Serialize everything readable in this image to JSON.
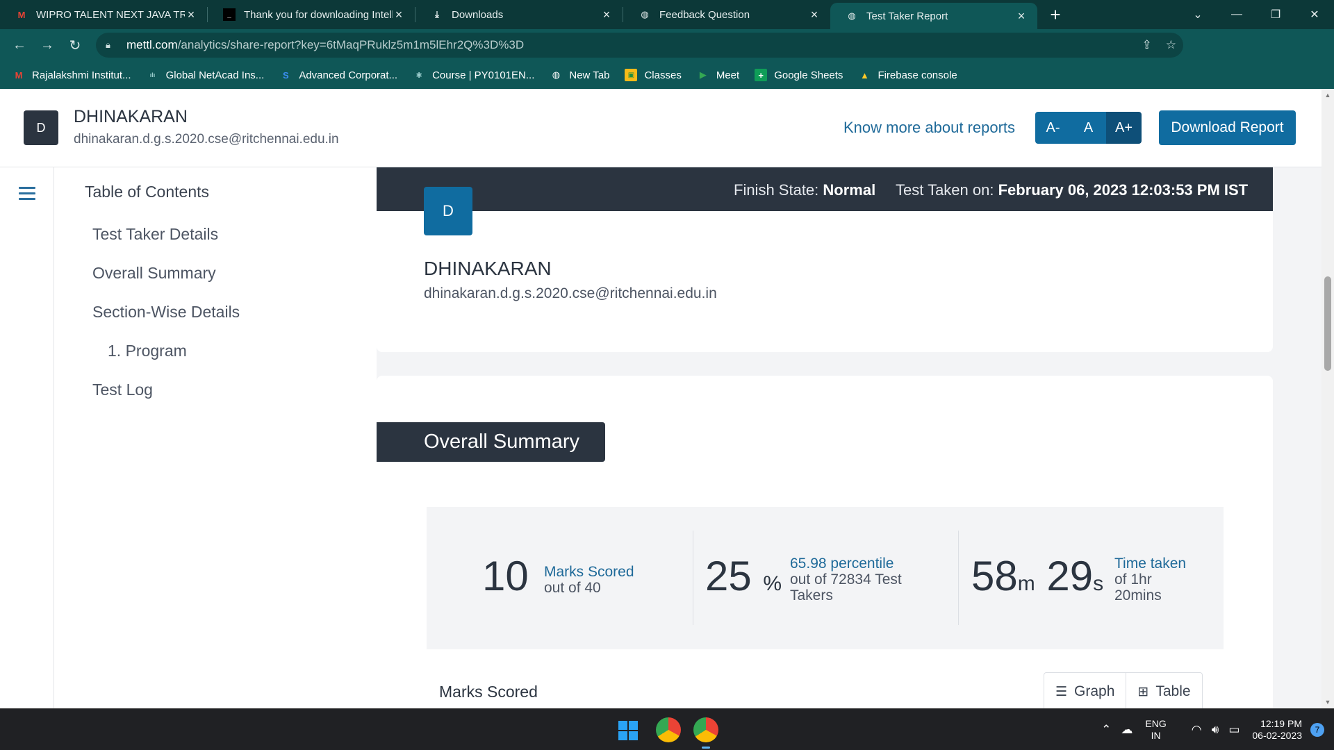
{
  "browser": {
    "tabs": [
      {
        "title": "WIPRO TALENT NEXT JAVA TRAIN",
        "icon": "gmail-icon"
      },
      {
        "title": "Thank you for downloading IntelliJ",
        "icon": "intellij-icon"
      },
      {
        "title": "Downloads",
        "icon": "download-icon"
      },
      {
        "title": "Feedback Question",
        "icon": "globe-icon"
      },
      {
        "title": "Test Taker Report",
        "icon": "globe-icon"
      }
    ],
    "url_host": "mettl.com",
    "url_path": "/analytics/share-report?key=6tMaqPRuklz5m1m5lEhr2Q%3D%3D",
    "bookmarks": [
      {
        "label": "Rajalakshmi Institut...",
        "icon": "gmail-icon"
      },
      {
        "label": "Global NetAcad Ins...",
        "icon": "cisco-icon"
      },
      {
        "label": "Advanced Corporat...",
        "icon": "s-logo-icon"
      },
      {
        "label": "Course | PY0101EN...",
        "icon": "cognitive-icon"
      },
      {
        "label": "New Tab",
        "icon": "globe-icon"
      },
      {
        "label": "Classes",
        "icon": "classroom-icon"
      },
      {
        "label": "Meet",
        "icon": "meet-icon"
      },
      {
        "label": "Google Sheets",
        "icon": "sheets-icon"
      },
      {
        "label": "Firebase console",
        "icon": "firebase-icon"
      }
    ]
  },
  "header": {
    "initial": "D",
    "name": "DHINAKARAN",
    "email": "dhinakaran.d.g.s.2020.cse@ritchennai.edu.in",
    "know_more": "Know more about reports",
    "font_small": "A-",
    "font_normal": "A",
    "font_large": "A+",
    "download": "Download Report"
  },
  "toc": {
    "title": "Table of Contents",
    "items": [
      "Test Taker Details",
      "Overall Summary",
      "Section-Wise Details",
      "1. Program",
      "Test Log"
    ]
  },
  "candidate": {
    "finish_label": "Finish State:",
    "finish_value": "Normal",
    "taken_label": "Test Taken on:",
    "taken_value": "February 06, 2023 12:03:53 PM IST",
    "initial": "D",
    "name": "DHINAKARAN",
    "email": "dhinakaran.d.g.s.2020.cse@ritchennai.edu.in"
  },
  "summary": {
    "heading": "Overall Summary",
    "marks_value": "10",
    "marks_label": "Marks Scored",
    "marks_sub": "out of 40",
    "percent_value": "25",
    "percent_unit": "%",
    "percentile_label": "65.98 percentile",
    "percentile_sub_1": "out of 72834 Test",
    "percentile_sub_2": "Takers",
    "time_min": "58",
    "time_min_unit": "m",
    "time_sec": "29",
    "time_sec_unit": "s",
    "time_label": "Time taken",
    "time_sub_1": "of 1hr",
    "time_sub_2": "20mins",
    "marks_scored_title": "Marks Scored",
    "graph_label": "Graph",
    "table_label": "Table"
  },
  "taskbar": {
    "lang_1": "ENG",
    "lang_2": "IN",
    "time": "12:19 PM",
    "date": "06-02-2023",
    "notif": "7"
  },
  "colors": {
    "chrome_dark": "#0c3838",
    "chrome": "#0f5757",
    "primary": "#106ca0",
    "dark": "#2b3440",
    "link": "#1f6a99"
  }
}
